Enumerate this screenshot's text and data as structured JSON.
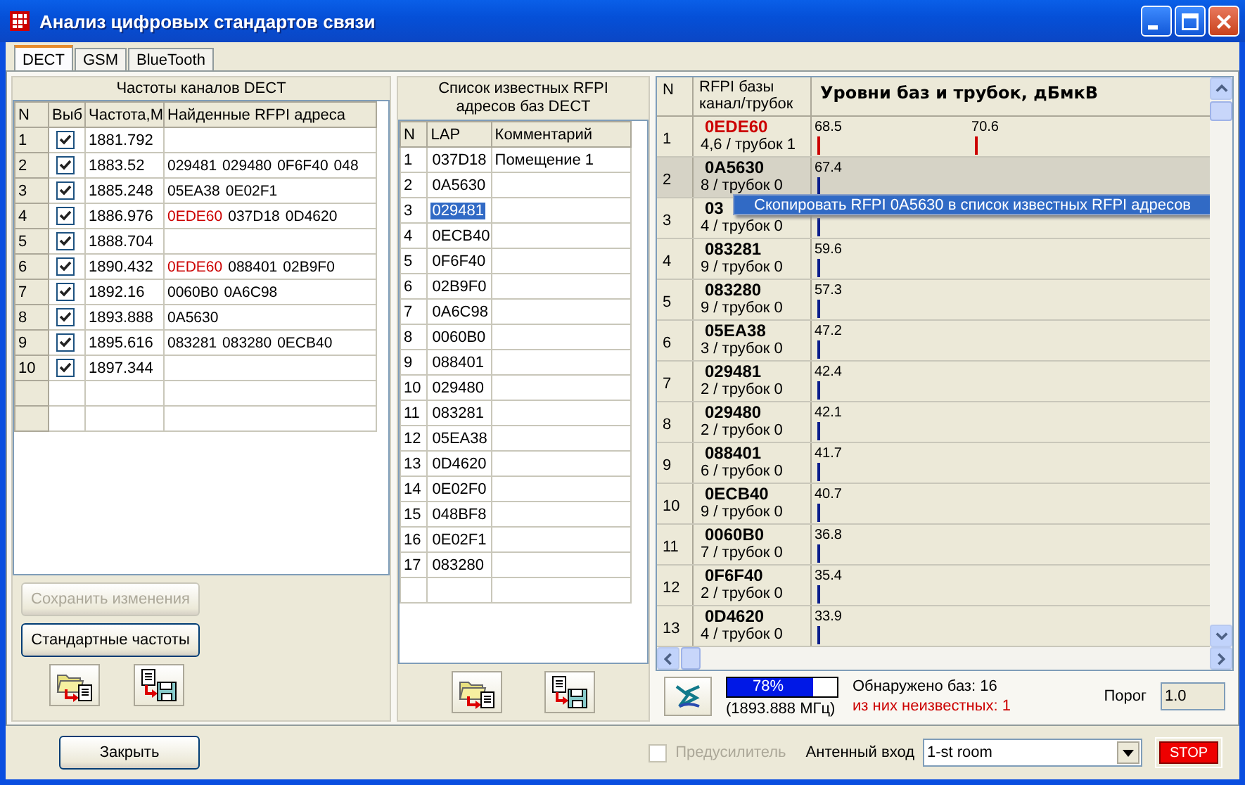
{
  "window": {
    "title": "Анализ цифровых стандартов связи"
  },
  "tabs": [
    {
      "label": "DECT",
      "selected": true
    },
    {
      "label": "GSM",
      "selected": false
    },
    {
      "label": "BlueTooth",
      "selected": false
    }
  ],
  "channels_panel": {
    "caption": "Частоты каналов DECT",
    "columns": [
      "N",
      "Выб",
      "Частота,М",
      "Найденные RFPI адреса"
    ],
    "rows": [
      {
        "n": "1",
        "checked": true,
        "frequency": "1881.792"
      },
      {
        "n": "2",
        "checked": true,
        "frequency": "1883.52",
        "addresses": [
          {
            "text": "029481",
            "unknown": false
          },
          {
            "text": "029480",
            "unknown": false
          },
          {
            "text": "0F6F40",
            "unknown": false
          },
          {
            "text": "048",
            "unknown": false
          }
        ]
      },
      {
        "n": "3",
        "checked": true,
        "frequency": "1885.248",
        "addresses": [
          {
            "text": "05EA38",
            "unknown": false
          },
          {
            "text": "0E02F1",
            "unknown": false
          }
        ]
      },
      {
        "n": "4",
        "checked": true,
        "frequency": "1886.976",
        "addresses": [
          {
            "text": "0EDE60",
            "unknown": true
          },
          {
            "text": "037D18",
            "unknown": false
          },
          {
            "text": "0D4620",
            "unknown": false
          }
        ]
      },
      {
        "n": "5",
        "checked": true,
        "frequency": "1888.704"
      },
      {
        "n": "6",
        "checked": true,
        "frequency": "1890.432",
        "addresses": [
          {
            "text": "0EDE60",
            "unknown": true
          },
          {
            "text": "088401",
            "unknown": false
          },
          {
            "text": "02B9F0",
            "unknown": false
          }
        ]
      },
      {
        "n": "7",
        "checked": true,
        "frequency": "1892.16",
        "addresses": [
          {
            "text": "0060B0",
            "unknown": false
          },
          {
            "text": "0A6C98",
            "unknown": false
          }
        ]
      },
      {
        "n": "8",
        "checked": true,
        "frequency": "1893.888",
        "addresses": [
          {
            "text": "0A5630",
            "unknown": false
          }
        ]
      },
      {
        "n": "9",
        "checked": true,
        "frequency": "1895.616",
        "addresses": [
          {
            "text": "083281",
            "unknown": false
          },
          {
            "text": "083280",
            "unknown": false
          },
          {
            "text": "0ECB40",
            "unknown": false
          }
        ]
      },
      {
        "n": "10",
        "checked": true,
        "frequency": "1897.344"
      }
    ],
    "buttons": [
      {
        "label": "Сохранить изменения",
        "disabled": true
      },
      {
        "label": "Стандартные частоты",
        "disabled": false
      }
    ]
  },
  "known_panel": {
    "caption": "Список известных RFPI адресов баз DECT",
    "columns": [
      "N",
      "LAP",
      "Комментарий"
    ],
    "rows": [
      {
        "n": "1",
        "lap": "037D18",
        "comment": "Помещение 1",
        "selected": false
      },
      {
        "n": "2",
        "lap": "0A5630",
        "selected": false
      },
      {
        "n": "3",
        "lap": "029481",
        "selected": true
      },
      {
        "n": "4",
        "lap": "0ECB40",
        "selected": false
      },
      {
        "n": "5",
        "lap": "0F6F40",
        "selected": false
      },
      {
        "n": "6",
        "lap": "02B9F0",
        "selected": false
      },
      {
        "n": "7",
        "lap": "0A6C98",
        "selected": false
      },
      {
        "n": "8",
        "lap": "0060B0",
        "selected": false
      },
      {
        "n": "9",
        "lap": "088401",
        "selected": false
      },
      {
        "n": "10",
        "lap": "029480",
        "selected": false
      },
      {
        "n": "11",
        "lap": "083281",
        "selected": false
      },
      {
        "n": "12",
        "lap": "05EA38",
        "selected": false
      },
      {
        "n": "13",
        "lap": "0D4620",
        "selected": false
      },
      {
        "n": "14",
        "lap": "0E02F0",
        "selected": false
      },
      {
        "n": "15",
        "lap": "048BF8",
        "selected": false
      },
      {
        "n": "16",
        "lap": "0E02F1",
        "selected": false
      },
      {
        "n": "17",
        "lap": "083280",
        "selected": false
      }
    ]
  },
  "levels_panel": {
    "columns": {
      "n": "N",
      "rfpi": "RFPI базы",
      "rfpi_sub": "канал/трубок",
      "levels": "Уровни баз и трубок, дБмкВ"
    },
    "rows": [
      {
        "n": "1",
        "rfpi": "0EDE60",
        "info": "4,6 / трубок 1",
        "unknown": true,
        "selected": false,
        "marks": [
          {
            "reading": "68.5",
            "level": 0
          },
          {
            "reading": "70.6",
            "level": 0.41
          }
        ]
      },
      {
        "n": "2",
        "rfpi": "0A5630",
        "info": "8 / трубок 0",
        "unknown": false,
        "selected": true,
        "marks": [
          {
            "reading": "67.4",
            "level": 0
          }
        ]
      },
      {
        "n": "3",
        "rfpi": "03",
        "info": "4 / трубок 0",
        "unknown": false,
        "selected": false,
        "marks": [
          {
            "level": 0
          }
        ]
      },
      {
        "n": "4",
        "rfpi": "083281",
        "info": "9 / трубок 0",
        "unknown": false,
        "selected": false,
        "marks": [
          {
            "reading": "59.6",
            "level": 0
          }
        ]
      },
      {
        "n": "5",
        "rfpi": "083280",
        "info": "9 / трубок 0",
        "unknown": false,
        "selected": false,
        "marks": [
          {
            "reading": "57.3",
            "level": 0
          }
        ]
      },
      {
        "n": "6",
        "rfpi": "05EA38",
        "info": "3 / трубок 0",
        "unknown": false,
        "selected": false,
        "marks": [
          {
            "reading": "47.2",
            "level": 0
          }
        ]
      },
      {
        "n": "7",
        "rfpi": "029481",
        "info": "2 / трубок 0",
        "unknown": false,
        "selected": false,
        "marks": [
          {
            "reading": "42.4",
            "level": 0
          }
        ]
      },
      {
        "n": "8",
        "rfpi": "029480",
        "info": "2 / трубок 0",
        "unknown": false,
        "selected": false,
        "marks": [
          {
            "reading": "42.1",
            "level": 0
          }
        ]
      },
      {
        "n": "9",
        "rfpi": "088401",
        "info": "6 / трубок 0",
        "unknown": false,
        "selected": false,
        "marks": [
          {
            "reading": "41.7",
            "level": 0
          }
        ]
      },
      {
        "n": "10",
        "rfpi": "0ECB40",
        "info": "9 / трубок 0",
        "unknown": false,
        "selected": false,
        "marks": [
          {
            "reading": "40.7",
            "level": 0
          }
        ]
      },
      {
        "n": "11",
        "rfpi": "0060B0",
        "info": "7 / трубок 0",
        "unknown": false,
        "selected": false,
        "marks": [
          {
            "reading": "36.8",
            "level": 0
          }
        ]
      },
      {
        "n": "12",
        "rfpi": "0F6F40",
        "info": "2 / трубок 0",
        "unknown": false,
        "selected": false,
        "marks": [
          {
            "reading": "35.4",
            "level": 0
          }
        ]
      },
      {
        "n": "13",
        "rfpi": "0D4620",
        "info": "4 / трубок 0",
        "unknown": false,
        "selected": false,
        "marks": [
          {
            "reading": "33.9",
            "level": 0
          }
        ]
      }
    ],
    "context_menu": {
      "item": "Скопировать RFPI 0A5630 в список известных RFPI адресов"
    },
    "status": {
      "progress": {
        "level": 0.78,
        "label": "78%"
      },
      "frequency": "(1893.888 МГц)",
      "found": "Обнаружено баз: 16",
      "unknown": "из них неизвестных: 1",
      "threshold_label": "Порог",
      "threshold": "1.0"
    }
  },
  "bottom_bar": {
    "close_button": "Закрыть",
    "preamp": {
      "label": "Предусилитель",
      "checked": false,
      "disabled": true
    },
    "antenna_label": "Антенный вход",
    "antenna": "1-st room",
    "stop_button": "STOP"
  }
}
